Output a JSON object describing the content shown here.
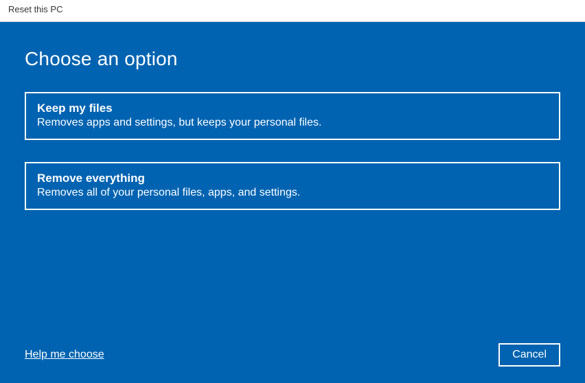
{
  "window": {
    "title": "Reset this PC"
  },
  "main": {
    "heading": "Choose an option",
    "options": [
      {
        "title": "Keep my files",
        "description": "Removes apps and settings, but keeps your personal files."
      },
      {
        "title": "Remove everything",
        "description": "Removes all of your personal files, apps, and settings."
      }
    ],
    "help_link": "Help me choose",
    "cancel_label": "Cancel"
  }
}
